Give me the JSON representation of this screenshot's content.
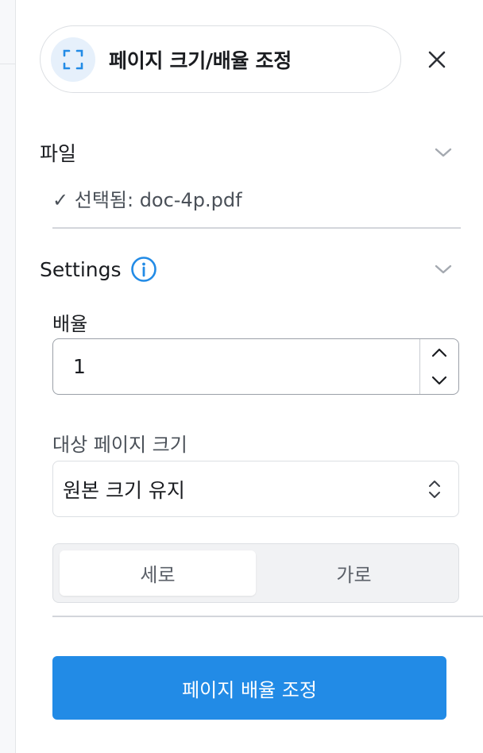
{
  "tool": {
    "title": "페이지 크기/배율 조정",
    "icon": "scale-frame-icon",
    "close_icon": "close-icon"
  },
  "file_section": {
    "title": "파일",
    "status": "✓ 선택됨: doc-4p.pdf",
    "expanded": true
  },
  "settings": {
    "title": "Settings",
    "info_icon": "info-icon",
    "scale": {
      "label": "배율",
      "value": "1"
    },
    "page_size": {
      "label": "대상 페이지 크기",
      "selected": "원본 크기 유지"
    },
    "orientation": {
      "options": [
        "세로",
        "가로"
      ],
      "selected": "세로"
    }
  },
  "submit_label": "페이지 배율 조정",
  "colors": {
    "accent": "#228be6",
    "icon_bg": "#e6f0fb",
    "text": "#1a1c20",
    "muted_text": "#4a5058"
  }
}
